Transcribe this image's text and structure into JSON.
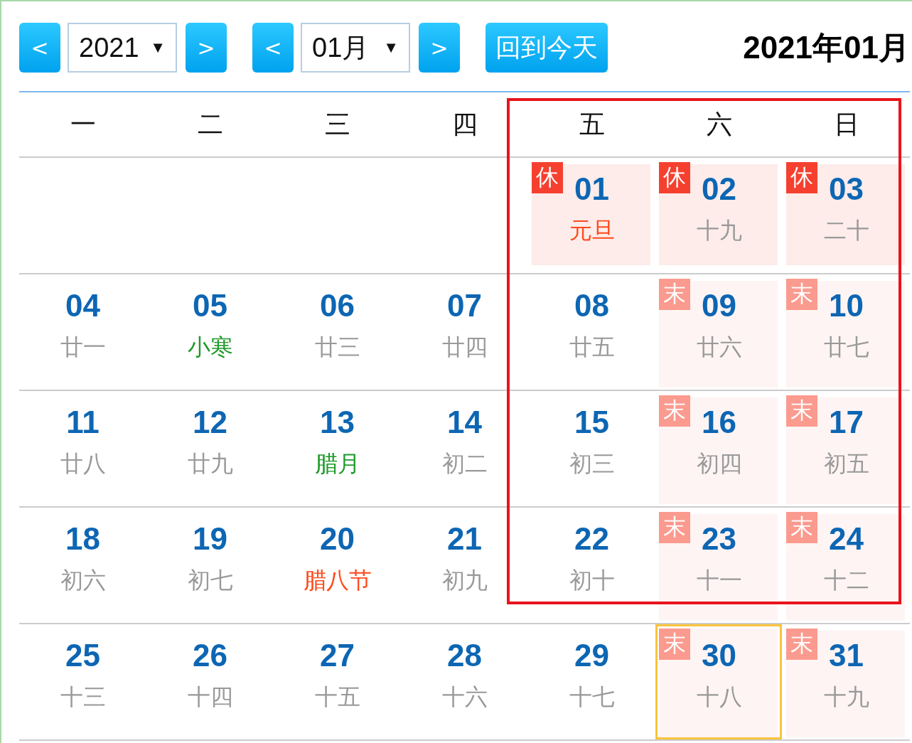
{
  "toolbar": {
    "year_prev": "<",
    "year_select": {
      "value": "2021",
      "caret": "▼"
    },
    "year_next": ">",
    "month_prev": "<",
    "month_select": {
      "value": "01月",
      "caret": "▼"
    },
    "month_next": ">",
    "today_button": "回到今天",
    "title": "2021年01月"
  },
  "weekdays": [
    "一",
    "二",
    "三",
    "四",
    "五",
    "六",
    "日"
  ],
  "weeks": [
    [
      {
        "kind": "empty"
      },
      {
        "kind": "empty"
      },
      {
        "kind": "empty"
      },
      {
        "kind": "empty"
      },
      {
        "kind": "day",
        "day": "01",
        "lunar": {
          "text": "元旦",
          "kind": "festival"
        },
        "badge": {
          "text": "休",
          "kind": "holiday"
        },
        "selected": false
      },
      {
        "kind": "day",
        "day": "02",
        "lunar": {
          "text": "十九",
          "kind": "plain"
        },
        "badge": {
          "text": "休",
          "kind": "holiday"
        },
        "selected": false
      },
      {
        "kind": "day",
        "day": "03",
        "lunar": {
          "text": "二十",
          "kind": "plain"
        },
        "badge": {
          "text": "休",
          "kind": "holiday"
        },
        "selected": false
      }
    ],
    [
      {
        "kind": "day",
        "day": "04",
        "lunar": {
          "text": "廿一",
          "kind": "plain"
        },
        "selected": false
      },
      {
        "kind": "day",
        "day": "05",
        "lunar": {
          "text": "小寒",
          "kind": "term"
        },
        "selected": false
      },
      {
        "kind": "day",
        "day": "06",
        "lunar": {
          "text": "廿三",
          "kind": "plain"
        },
        "selected": false
      },
      {
        "kind": "day",
        "day": "07",
        "lunar": {
          "text": "廿四",
          "kind": "plain"
        },
        "selected": false
      },
      {
        "kind": "day",
        "day": "08",
        "lunar": {
          "text": "廿五",
          "kind": "plain"
        },
        "selected": false
      },
      {
        "kind": "day",
        "day": "09",
        "lunar": {
          "text": "廿六",
          "kind": "plain"
        },
        "badge": {
          "text": "末",
          "kind": "weekend"
        },
        "selected": false
      },
      {
        "kind": "day",
        "day": "10",
        "lunar": {
          "text": "廿七",
          "kind": "plain"
        },
        "badge": {
          "text": "末",
          "kind": "weekend"
        },
        "selected": false
      }
    ],
    [
      {
        "kind": "day",
        "day": "11",
        "lunar": {
          "text": "廿八",
          "kind": "plain"
        },
        "selected": false
      },
      {
        "kind": "day",
        "day": "12",
        "lunar": {
          "text": "廿九",
          "kind": "plain"
        },
        "selected": false
      },
      {
        "kind": "day",
        "day": "13",
        "lunar": {
          "text": "腊月",
          "kind": "term"
        },
        "selected": false
      },
      {
        "kind": "day",
        "day": "14",
        "lunar": {
          "text": "初二",
          "kind": "plain"
        },
        "selected": false
      },
      {
        "kind": "day",
        "day": "15",
        "lunar": {
          "text": "初三",
          "kind": "plain"
        },
        "selected": false
      },
      {
        "kind": "day",
        "day": "16",
        "lunar": {
          "text": "初四",
          "kind": "plain"
        },
        "badge": {
          "text": "末",
          "kind": "weekend"
        },
        "selected": false
      },
      {
        "kind": "day",
        "day": "17",
        "lunar": {
          "text": "初五",
          "kind": "plain"
        },
        "badge": {
          "text": "末",
          "kind": "weekend"
        },
        "selected": false
      }
    ],
    [
      {
        "kind": "day",
        "day": "18",
        "lunar": {
          "text": "初六",
          "kind": "plain"
        },
        "selected": false
      },
      {
        "kind": "day",
        "day": "19",
        "lunar": {
          "text": "初七",
          "kind": "plain"
        },
        "selected": false
      },
      {
        "kind": "day",
        "day": "20",
        "lunar": {
          "text": "腊八节",
          "kind": "festival"
        },
        "selected": false
      },
      {
        "kind": "day",
        "day": "21",
        "lunar": {
          "text": "初九",
          "kind": "plain"
        },
        "selected": false
      },
      {
        "kind": "day",
        "day": "22",
        "lunar": {
          "text": "初十",
          "kind": "plain"
        },
        "selected": false
      },
      {
        "kind": "day",
        "day": "23",
        "lunar": {
          "text": "十一",
          "kind": "plain"
        },
        "badge": {
          "text": "末",
          "kind": "weekend"
        },
        "selected": false
      },
      {
        "kind": "day",
        "day": "24",
        "lunar": {
          "text": "十二",
          "kind": "plain"
        },
        "badge": {
          "text": "末",
          "kind": "weekend"
        },
        "selected": false
      }
    ],
    [
      {
        "kind": "day",
        "day": "25",
        "lunar": {
          "text": "十三",
          "kind": "plain"
        },
        "selected": false
      },
      {
        "kind": "day",
        "day": "26",
        "lunar": {
          "text": "十四",
          "kind": "plain"
        },
        "selected": false
      },
      {
        "kind": "day",
        "day": "27",
        "lunar": {
          "text": "十五",
          "kind": "plain"
        },
        "selected": false
      },
      {
        "kind": "day",
        "day": "28",
        "lunar": {
          "text": "十六",
          "kind": "plain"
        },
        "selected": false
      },
      {
        "kind": "day",
        "day": "29",
        "lunar": {
          "text": "十七",
          "kind": "plain"
        },
        "selected": false
      },
      {
        "kind": "day",
        "day": "30",
        "lunar": {
          "text": "十八",
          "kind": "plain"
        },
        "badge": {
          "text": "末",
          "kind": "weekend"
        },
        "selected": true
      },
      {
        "kind": "day",
        "day": "31",
        "lunar": {
          "text": "十九",
          "kind": "plain"
        },
        "badge": {
          "text": "末",
          "kind": "weekend"
        },
        "selected": false
      }
    ]
  ],
  "annotation": {
    "kind": "frame"
  }
}
